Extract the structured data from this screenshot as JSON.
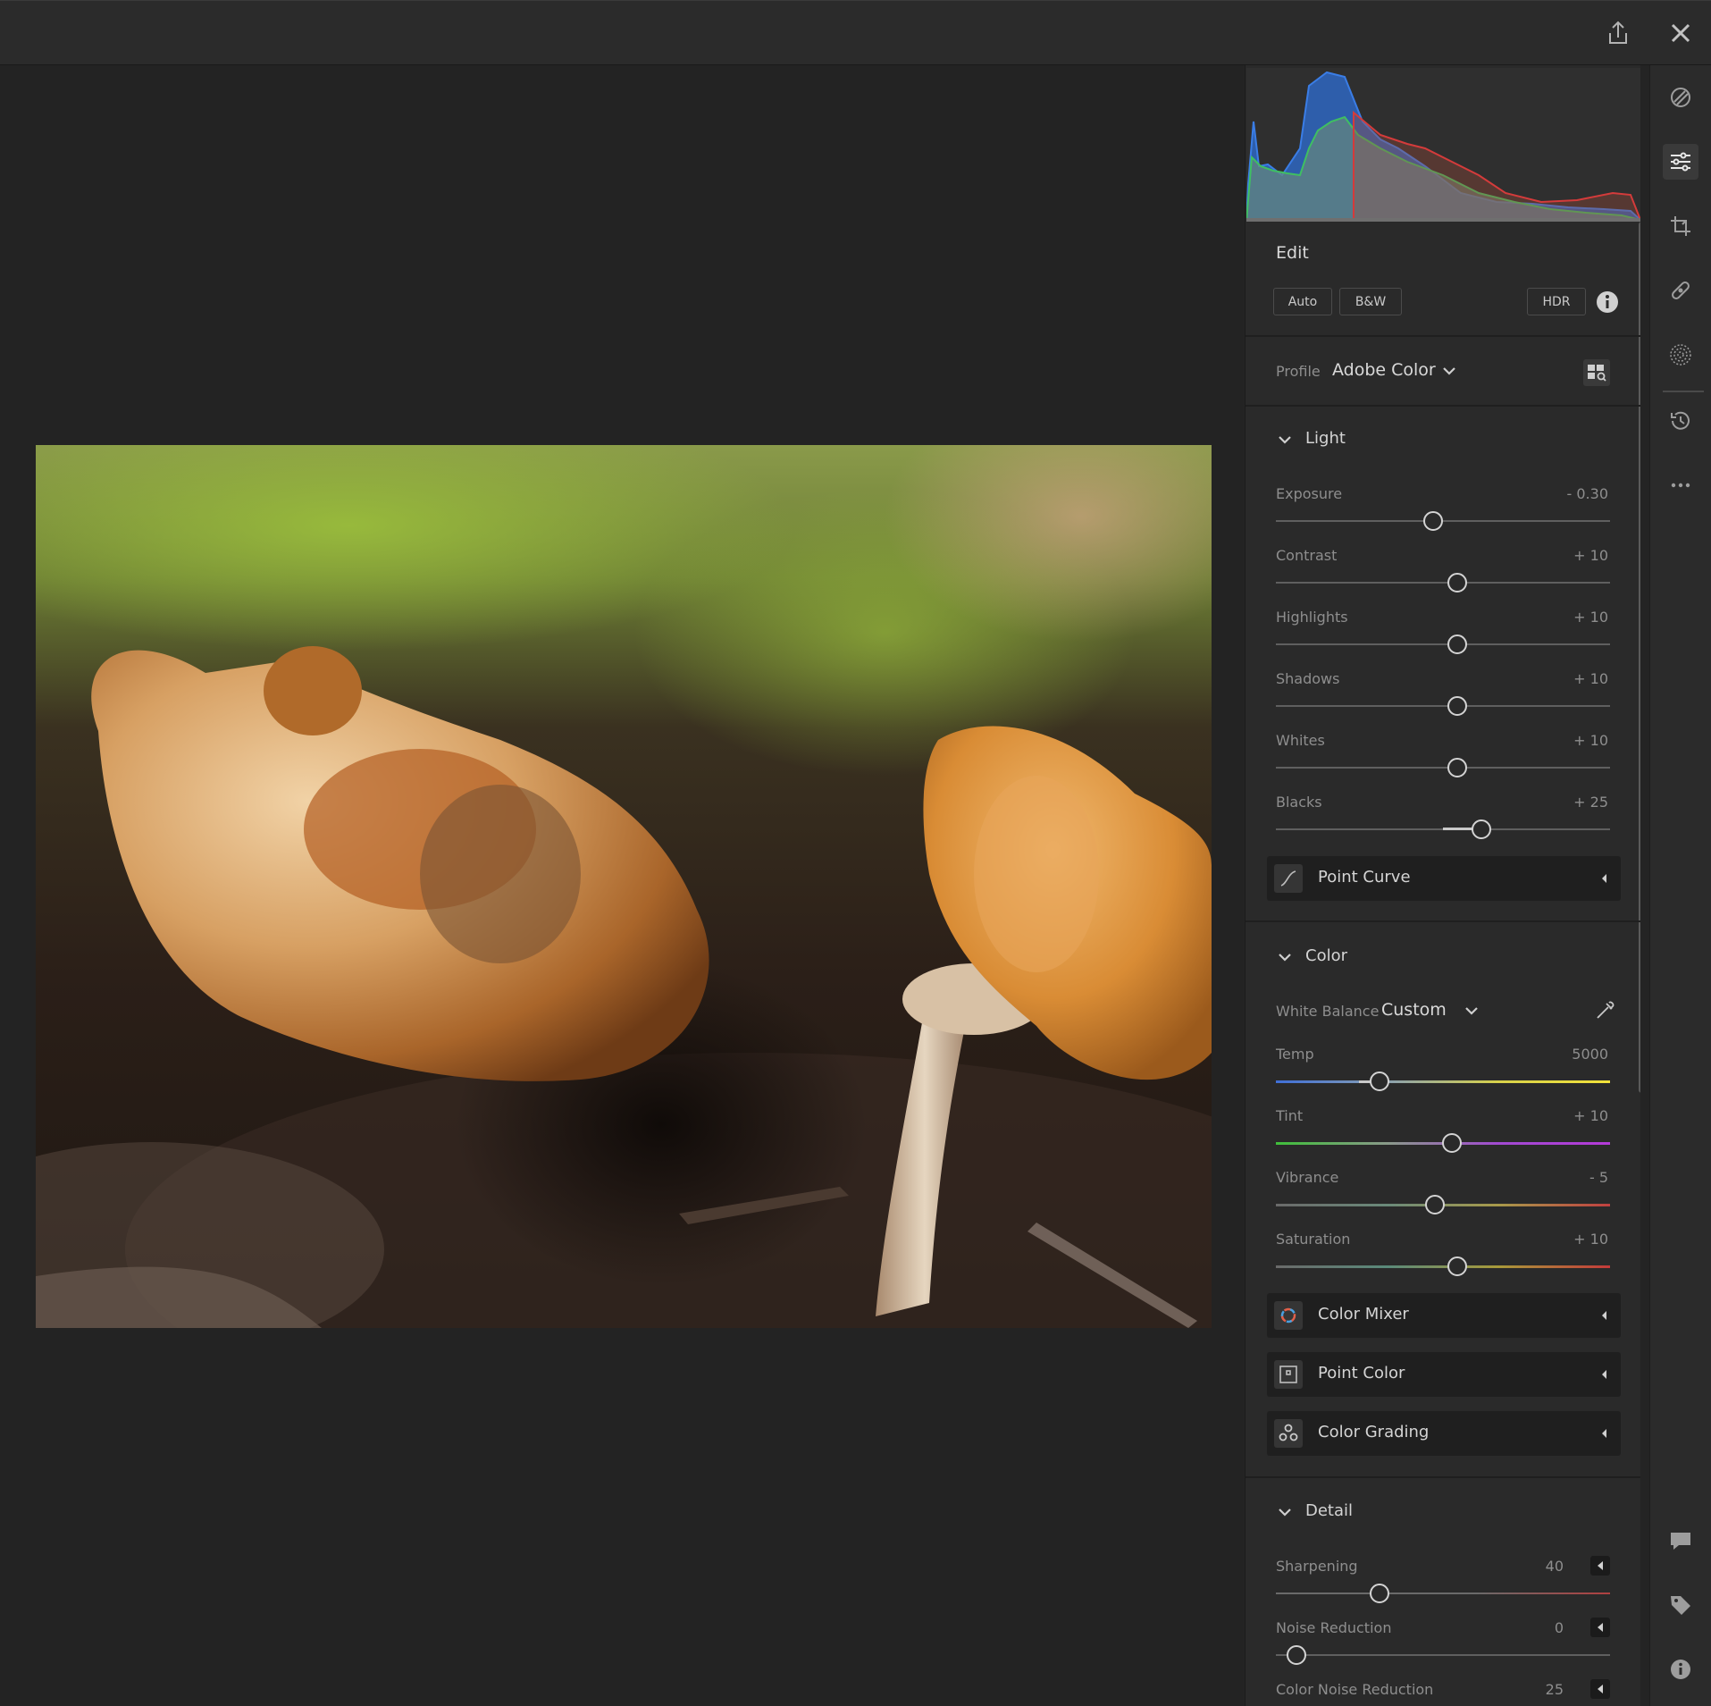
{
  "edit": {
    "title": "Edit",
    "buttons": {
      "auto": "Auto",
      "bw": "B&W",
      "hdr": "HDR"
    }
  },
  "profile": {
    "label": "Profile",
    "value": "Adobe Color"
  },
  "light": {
    "title": "Light",
    "sliders": [
      {
        "label": "Exposure",
        "value": "- 0.30"
      },
      {
        "label": "Contrast",
        "value": "+ 10"
      },
      {
        "label": "Highlights",
        "value": "+ 10"
      },
      {
        "label": "Shadows",
        "value": "+ 10"
      },
      {
        "label": "Whites",
        "value": "+ 10"
      },
      {
        "label": "Blacks",
        "value": "+ 25"
      }
    ],
    "point_curve": "Point Curve"
  },
  "color": {
    "title": "Color",
    "white_balance": {
      "label": "White Balance",
      "value": "Custom"
    },
    "sliders": [
      {
        "label": "Temp",
        "value": "5000"
      },
      {
        "label": "Tint",
        "value": "+ 10"
      },
      {
        "label": "Vibrance",
        "value": "- 5"
      },
      {
        "label": "Saturation",
        "value": "+ 10"
      }
    ],
    "color_mixer": "Color Mixer",
    "point_color": "Point Color",
    "color_grading": "Color Grading"
  },
  "detail": {
    "title": "Detail",
    "sliders": [
      {
        "label": "Sharpening",
        "value": "40"
      },
      {
        "label": "Noise Reduction",
        "value": "0"
      },
      {
        "label": "Color Noise Reduction",
        "value": "25"
      }
    ]
  },
  "colors": {
    "panel_bg": "#2a2a2a",
    "subpanel_bg": "#1f1f1f",
    "histogram_blue": "#2f6fd6",
    "histogram_green": "#3fbf62",
    "histogram_red": "#d43b3b"
  },
  "icons": {
    "top": [
      "share-icon",
      "close-icon"
    ],
    "toolbar": [
      "presets-icon",
      "edit-sliders-icon",
      "crop-icon",
      "healing-icon",
      "masking-icon",
      "history-icon",
      "more-icon",
      "comment-icon",
      "tag-icon",
      "info-icon"
    ]
  }
}
